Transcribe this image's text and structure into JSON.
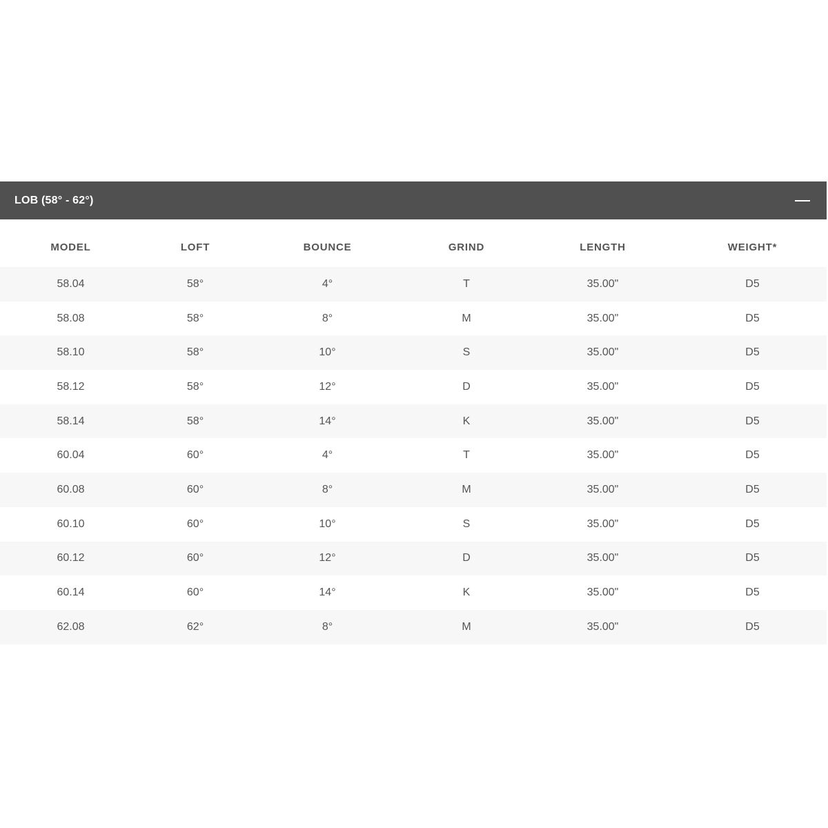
{
  "accordion": {
    "title": "LOB (58° - 62°)",
    "toggle_icon": "minus-icon"
  },
  "table": {
    "columns": [
      "MODEL",
      "LOFT",
      "BOUNCE",
      "GRIND",
      "LENGTH",
      "WEIGHT*"
    ],
    "rows": [
      [
        "58.04",
        "58°",
        "4°",
        "T",
        "35.00\"",
        "D5"
      ],
      [
        "58.08",
        "58°",
        "8°",
        "M",
        "35.00\"",
        "D5"
      ],
      [
        "58.10",
        "58°",
        "10°",
        "S",
        "35.00\"",
        "D5"
      ],
      [
        "58.12",
        "58°",
        "12°",
        "D",
        "35.00\"",
        "D5"
      ],
      [
        "58.14",
        "58°",
        "14°",
        "K",
        "35.00\"",
        "D5"
      ],
      [
        "60.04",
        "60°",
        "4°",
        "T",
        "35.00\"",
        "D5"
      ],
      [
        "60.08",
        "60°",
        "8°",
        "M",
        "35.00\"",
        "D5"
      ],
      [
        "60.10",
        "60°",
        "10°",
        "S",
        "35.00\"",
        "D5"
      ],
      [
        "60.12",
        "60°",
        "12°",
        "D",
        "35.00\"",
        "D5"
      ],
      [
        "60.14",
        "60°",
        "14°",
        "K",
        "35.00\"",
        "D5"
      ],
      [
        "62.08",
        "62°",
        "8°",
        "M",
        "35.00\"",
        "D5"
      ]
    ]
  },
  "colors": {
    "header_bg": "#505050",
    "header_text": "#ffffff",
    "stripe_bg": "#f7f7f7",
    "text": "#555555"
  }
}
